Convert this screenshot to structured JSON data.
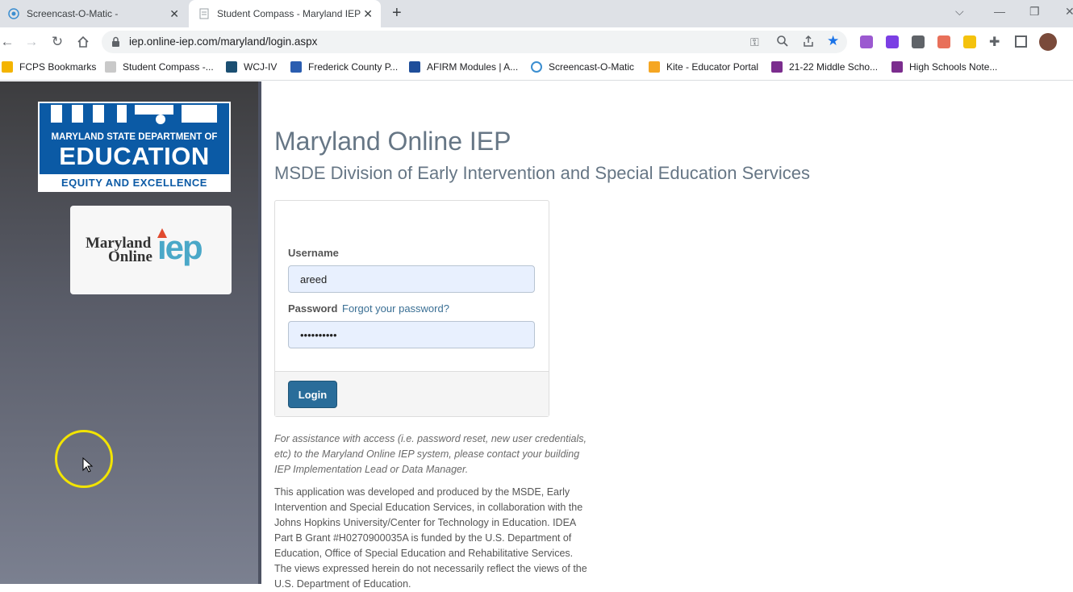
{
  "browser": {
    "tabs": [
      {
        "title": "Screencast-O-Matic -",
        "close": "✕"
      },
      {
        "title": "Student Compass - Maryland IEP",
        "close": "✕"
      }
    ],
    "new_tab": "+",
    "url": "iep.online-iep.com/maryland/login.aspx",
    "bookmarks": [
      {
        "label": "FCPS Bookmarks",
        "icon_color": "#f4b400"
      },
      {
        "label": "Student Compass -...",
        "icon_color": "#c9c9c9"
      },
      {
        "label": "WCJ-IV",
        "icon_color": "#1b4f72"
      },
      {
        "label": "Frederick County P...",
        "icon_color": "#2a5db0"
      },
      {
        "label": "AFIRM Modules | A...",
        "icon_color": "#1f4e9a"
      },
      {
        "label": "Screencast-O-Matic",
        "icon_color": "#3b8ed0"
      },
      {
        "label": "Kite - Educator Portal",
        "icon_color": "#f5a623"
      },
      {
        "label": "21-22 Middle Scho...",
        "icon_color": "#7b2d8e"
      },
      {
        "label": "High Schools Note...",
        "icon_color": "#7b2d8e"
      }
    ]
  },
  "sidebar": {
    "msde_logo": {
      "line1": "MARYLAND STATE DEPARTMENT OF",
      "line2": "EDUCATION",
      "line3": "EQUITY AND EXCELLENCE"
    },
    "iep_logo": {
      "word1": "Maryland",
      "word2": "Online",
      "word3": "iep"
    }
  },
  "main": {
    "title": "Maryland Online IEP",
    "subtitle": "MSDE Division of Early Intervention and Special Education Services",
    "login": {
      "username_label": "Username",
      "username_value": "areed",
      "password_label": "Password",
      "forgot_link": "Forgot your password?",
      "password_value": "••••••••••",
      "login_button": "Login"
    },
    "assistance": "For assistance with access (i.e. password reset, new user credentials, etc) to the Maryland Online IEP system, please contact your building IEP Implementation Lead or Data Manager.",
    "disclaimer": "This application was developed and produced by the MSDE, Early Intervention and Special Education Services, in collaboration with the Johns Hopkins University/Center for Technology in Education. IDEA Part B Grant #H0270900035A is funded by the U.S. Department of Education, Office of Special Education and Rehabilitative Services. The views expressed herein do not necessarily reflect the views of the U.S. Department of Education."
  },
  "colors": {
    "accent": "#2a6d9a",
    "heading": "#667685",
    "msde_blue": "#0b5aa5",
    "cursor_highlight": "#f2e400"
  }
}
